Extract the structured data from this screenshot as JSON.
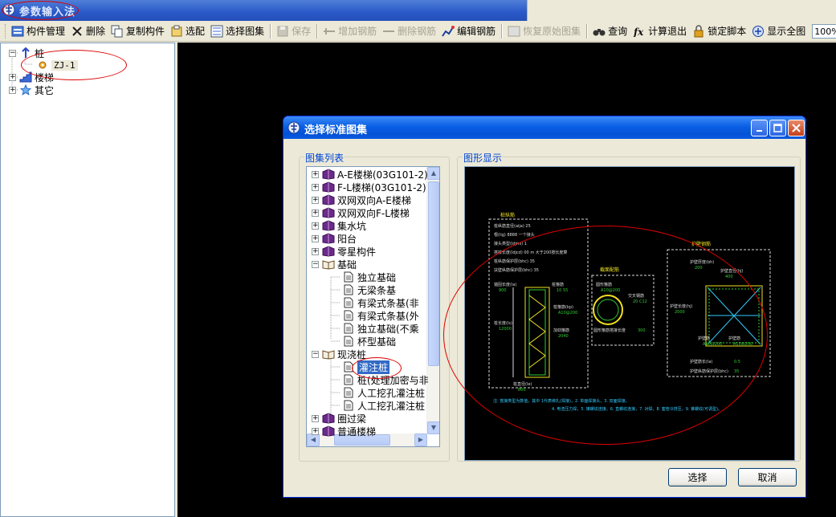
{
  "window": {
    "title": "参数输入法"
  },
  "toolbar": {
    "items": [
      {
        "label": "构件管理",
        "icon": "component-manage-icon",
        "disabled": false
      },
      {
        "label": "删除",
        "icon": "delete-x-icon",
        "disabled": false
      },
      {
        "label": "复制构件",
        "icon": "copy-icon",
        "disabled": false
      },
      {
        "label": "选配",
        "icon": "match-icon",
        "disabled": false
      },
      {
        "label": "选择图集",
        "icon": "atlas-icon",
        "disabled": false
      },
      {
        "label": "保存",
        "icon": "save-icon",
        "disabled": true
      },
      {
        "label": "增加钢筋",
        "icon": "add-rebar-icon",
        "disabled": true
      },
      {
        "label": "删除钢筋",
        "icon": "remove-rebar-icon",
        "disabled": true
      },
      {
        "label": "编辑钢筋",
        "icon": "edit-rebar-icon",
        "disabled": false
      },
      {
        "label": "恢复原始图集",
        "icon": "restore-icon",
        "disabled": true
      },
      {
        "label": "查询",
        "icon": "binoculars-icon",
        "disabled": false
      },
      {
        "label": "计算退出",
        "icon": "fx-icon",
        "disabled": false
      },
      {
        "label": "锁定脚本",
        "icon": "lock-icon",
        "disabled": false
      },
      {
        "label": "显示全图",
        "icon": "zoom-fit-icon",
        "disabled": false
      }
    ],
    "zoom": "100%"
  },
  "tree": {
    "root_pile": "桩",
    "child_zj": "ZJ-1",
    "stairs": "楼梯",
    "other": "其它"
  },
  "dialog": {
    "title": "选择标准图集",
    "list_group_label": "图集列表",
    "preview_group_label": "图形显示",
    "list_items": [
      {
        "label": "A-E楼梯(03G101-2)",
        "level": 0,
        "type": "book",
        "exp": "+"
      },
      {
        "label": "F-L楼梯(03G101-2)",
        "level": 0,
        "type": "book",
        "exp": "+"
      },
      {
        "label": "双网双向A-E楼梯",
        "level": 0,
        "type": "book",
        "exp": "+"
      },
      {
        "label": "双网双向F-L楼梯",
        "level": 0,
        "type": "book",
        "exp": "+"
      },
      {
        "label": "集水坑",
        "level": 0,
        "type": "book",
        "exp": "+"
      },
      {
        "label": "阳台",
        "level": 0,
        "type": "book",
        "exp": "+"
      },
      {
        "label": "零星构件",
        "level": 0,
        "type": "book",
        "exp": "+"
      },
      {
        "label": "基础",
        "level": 0,
        "type": "open-book",
        "exp": "-"
      },
      {
        "label": "独立基础",
        "level": 1,
        "type": "doc",
        "exp": ""
      },
      {
        "label": "无梁条基",
        "level": 1,
        "type": "doc",
        "exp": ""
      },
      {
        "label": "有梁式条基(非",
        "level": 1,
        "type": "doc",
        "exp": ""
      },
      {
        "label": "有梁式条基(外",
        "level": 1,
        "type": "doc",
        "exp": ""
      },
      {
        "label": "独立基础(不乘",
        "level": 1,
        "type": "doc",
        "exp": ""
      },
      {
        "label": "杯型基础",
        "level": 1,
        "type": "doc",
        "exp": ""
      },
      {
        "label": "现浇桩",
        "level": 0,
        "type": "open-book",
        "exp": "-"
      },
      {
        "label": "灌注桩",
        "level": 1,
        "type": "doc",
        "exp": "",
        "selected": true
      },
      {
        "label": "桩(处理加密与非",
        "level": 1,
        "type": "doc",
        "exp": ""
      },
      {
        "label": "人工挖孔灌注桩",
        "level": 1,
        "type": "doc",
        "exp": ""
      },
      {
        "label": "人工挖孔灌注桩",
        "level": 1,
        "type": "doc",
        "exp": ""
      },
      {
        "label": "圈过梁",
        "level": 0,
        "type": "book",
        "exp": "+"
      },
      {
        "label": "普通楼梯",
        "level": 0,
        "type": "book",
        "exp": "+"
      }
    ],
    "select_button": "选择",
    "cancel_button": "取消"
  },
  "drawing": {
    "pile_title": "桩纵筋",
    "section_title": "截面配筋",
    "guard_title": "护壁钢筋",
    "left_lines": [
      "桩纵筋直径(aija) 25",
      "根(lig) 8888  一个接头",
      "接头类型(ldjmi) 1",
      "搭接长度(ldjcd) 00 m 大于200按长度算",
      "桩纵筋保护层(bhc) 35",
      "扶壁纵筋保护层(bhc) 35"
    ],
    "left_labels": [
      "锚固长度(la)",
      "桩箍筋",
      "桩箍筋(kp)",
      "桩长度(ls)",
      "加劲箍筋",
      "桩直径(le)"
    ],
    "left_values": [
      "900",
      "10 55",
      "A10@200",
      "12000",
      "2040",
      "800"
    ],
    "section_labels": [
      "圆形箍筋",
      "交叉钢筋",
      "圆形箍筋搭接长度"
    ],
    "section_values": [
      "A10@200",
      "20 C12",
      "300"
    ],
    "guard_labels": [
      "护壁厚度(bh)",
      "护壁直径(hj)",
      "护壁长度(hj)",
      "护壁筋",
      "护壁筋",
      "护壁筋长(la)",
      "护壁纵筋保护层(bhc)"
    ],
    "guard_values": [
      "200",
      "400",
      "2000",
      "A10@200",
      "A10@200",
      "0.5",
      "35"
    ],
    "note_line1": "注: 搭接类型为数值，其中 1代表绑扎(焊接)，2. 单面焊接头，3. 双面焊接，",
    "note_line2": "4. 电渣压力焊，5. 锥螺纹连接，6. 直螺纹连接，7. 对焊，8. 套管冷挤压，9. 锥螺纹(可调型)。"
  }
}
